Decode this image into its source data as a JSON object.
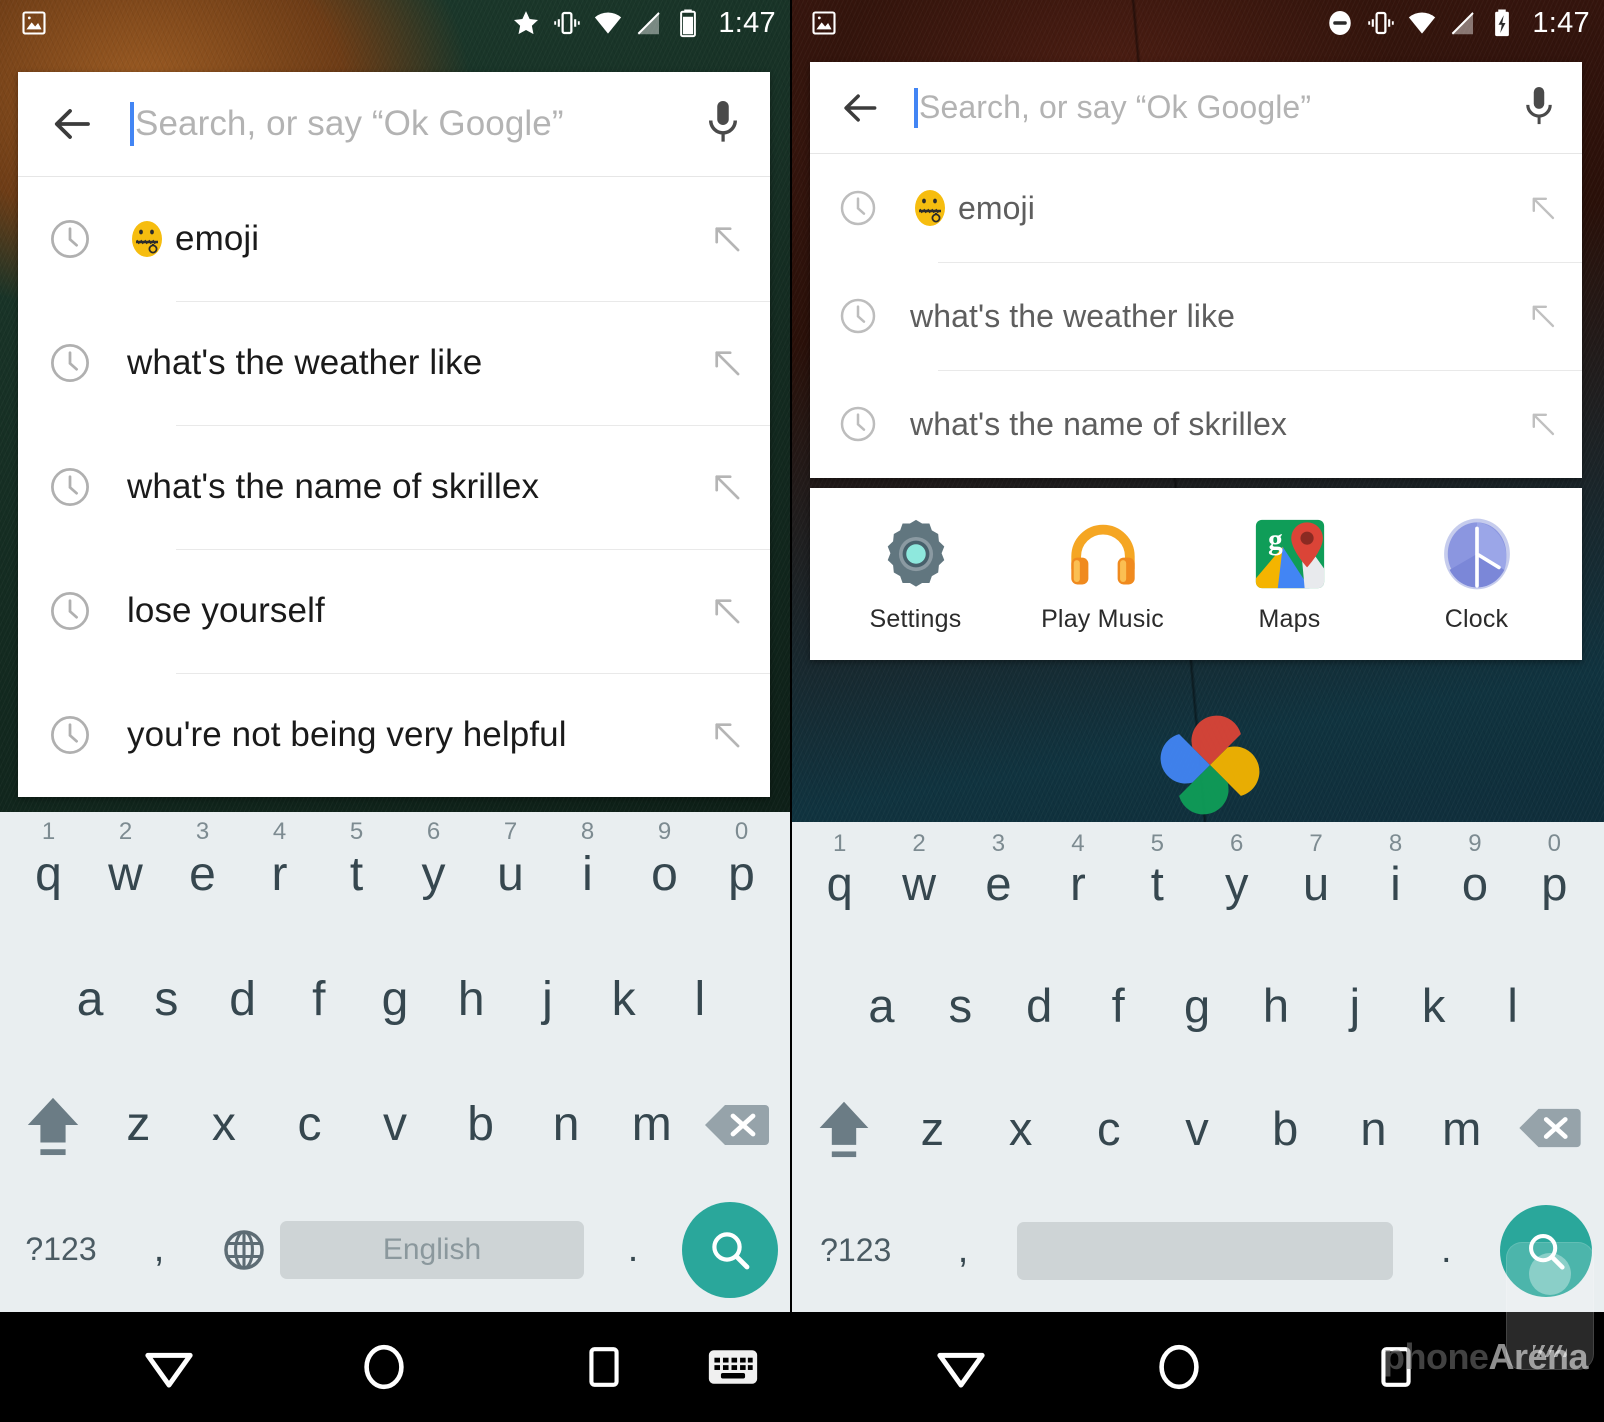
{
  "screens": [
    {
      "id": "left",
      "status_bar": {
        "notification_icon": "photo-icon",
        "icons": [
          "star-icon",
          "vibrate-icon",
          "wifi-icon",
          "cell-signal-icon",
          "battery-icon"
        ],
        "time": "1:47"
      },
      "search": {
        "back_icon": "back-arrow-icon",
        "placeholder": "Search, or say “Ok Google”",
        "value": "",
        "mic_icon": "microphone-icon"
      },
      "suggestions": [
        {
          "icon": "clock-icon",
          "emoji": "🤐",
          "text": "emoji",
          "action_icon": "arrow-up-left-icon"
        },
        {
          "icon": "clock-icon",
          "emoji": "",
          "text": "what's the weather like",
          "action_icon": "arrow-up-left-icon"
        },
        {
          "icon": "clock-icon",
          "emoji": "",
          "text": "what's the name of skrillex",
          "action_icon": "arrow-up-left-icon"
        },
        {
          "icon": "clock-icon",
          "emoji": "",
          "text": "lose yourself",
          "action_icon": "arrow-up-left-icon"
        },
        {
          "icon": "clock-icon",
          "emoji": "",
          "text": "you're not being very helpful",
          "action_icon": "arrow-up-left-icon"
        }
      ],
      "app_shortcuts": [],
      "keyboard": {
        "row1": [
          {
            "num": "1",
            "char": "q"
          },
          {
            "num": "2",
            "char": "w"
          },
          {
            "num": "3",
            "char": "e"
          },
          {
            "num": "4",
            "char": "r"
          },
          {
            "num": "5",
            "char": "t"
          },
          {
            "num": "6",
            "char": "y"
          },
          {
            "num": "7",
            "char": "u"
          },
          {
            "num": "8",
            "char": "i"
          },
          {
            "num": "9",
            "char": "o"
          },
          {
            "num": "0",
            "char": "p"
          }
        ],
        "row2": [
          "a",
          "s",
          "d",
          "f",
          "g",
          "h",
          "j",
          "k",
          "l"
        ],
        "row3": [
          "z",
          "x",
          "c",
          "v",
          "b",
          "n",
          "m"
        ],
        "shift_icon": "shift-icon",
        "backspace_icon": "backspace-icon",
        "symbols_label": "?123",
        "comma_label": ",",
        "period_label": ".",
        "globe_icon": "globe-icon",
        "space_label": "English",
        "enter_icon": "search-icon"
      },
      "nav_bar": {
        "back_icon": "down-triangle-icon",
        "home_icon": "circle-home-icon",
        "recents_icon": "square-recents-icon",
        "keyboard_icon": "keyboard-icon"
      },
      "watermark": null,
      "drag_handle": false
    },
    {
      "id": "right",
      "status_bar": {
        "notification_icon": "photo-icon",
        "icons": [
          "do-not-disturb-icon",
          "vibrate-icon",
          "wifi-icon",
          "cell-signal-icon",
          "battery-charging-icon"
        ],
        "time": "1:47"
      },
      "search": {
        "back_icon": "back-arrow-icon",
        "placeholder": "Search, or say “Ok Google”",
        "value": "",
        "mic_icon": "microphone-icon"
      },
      "suggestions": [
        {
          "icon": "clock-icon",
          "emoji": "🤐",
          "text": "emoji",
          "action_icon": "arrow-up-left-icon"
        },
        {
          "icon": "clock-icon",
          "emoji": "",
          "text": "what's the weather like",
          "action_icon": "arrow-up-left-icon"
        },
        {
          "icon": "clock-icon",
          "emoji": "",
          "text": "what's the name of skrillex",
          "action_icon": "arrow-up-left-icon"
        }
      ],
      "app_shortcuts": [
        {
          "icon": "settings-gear-icon",
          "label": "Settings"
        },
        {
          "icon": "play-music-headphones-icon",
          "label": "Play Music"
        },
        {
          "icon": "maps-pin-icon",
          "label": "Maps"
        },
        {
          "icon": "clock-app-icon",
          "label": "Clock"
        }
      ],
      "keyboard": {
        "row1": [
          {
            "num": "1",
            "char": "q"
          },
          {
            "num": "2",
            "char": "w"
          },
          {
            "num": "3",
            "char": "e"
          },
          {
            "num": "4",
            "char": "r"
          },
          {
            "num": "5",
            "char": "t"
          },
          {
            "num": "6",
            "char": "y"
          },
          {
            "num": "7",
            "char": "u"
          },
          {
            "num": "8",
            "char": "i"
          },
          {
            "num": "9",
            "char": "o"
          },
          {
            "num": "0",
            "char": "p"
          }
        ],
        "row2": [
          "a",
          "s",
          "d",
          "f",
          "g",
          "h",
          "j",
          "k",
          "l"
        ],
        "row3": [
          "z",
          "x",
          "c",
          "v",
          "b",
          "n",
          "m"
        ],
        "shift_icon": "shift-icon",
        "backspace_icon": "backspace-icon",
        "symbols_label": "?123",
        "comma_label": ",",
        "period_label": ".",
        "globe_icon": null,
        "space_label": "",
        "enter_icon": "search-icon"
      },
      "nav_bar": {
        "back_icon": "down-triangle-icon",
        "home_icon": "circle-home-icon",
        "recents_icon": "square-recents-icon",
        "keyboard_icon": null
      },
      "watermark": {
        "part1": "phone",
        "part2": "Arena"
      },
      "drag_handle": true
    }
  ],
  "colors": {
    "accent_teal": "#2aa79b",
    "caret_blue": "#4285f4",
    "keyboard_bg": "#e9eef0",
    "key_text": "#36474f",
    "card_bg": "#ffffff",
    "nav_bg": "#000000",
    "suggestion_text_left": "#1a1a1a",
    "suggestion_text_right": "#5e5e5e",
    "placeholder": "#b3b3b3"
  }
}
